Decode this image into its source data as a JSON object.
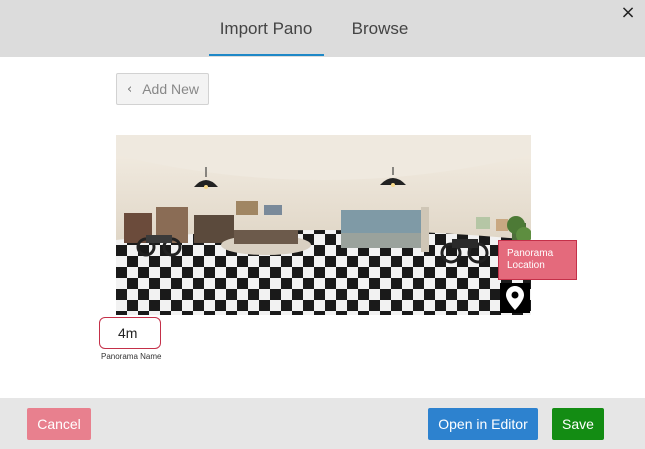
{
  "header": {
    "tabs": [
      {
        "label": "Import Pano",
        "active": true
      },
      {
        "label": "Browse",
        "active": false
      }
    ],
    "close_symbol": "×",
    "active_color": "#1e88c7"
  },
  "toolbar": {
    "add_new_label": "Add New",
    "add_new_icon": "chevron-left-icon"
  },
  "pano": {
    "location_tag": "Panorama Location",
    "pin_icon": "map-pin-icon"
  },
  "name_field": {
    "value": "4m",
    "label": "Panorama Name",
    "border_color": "#c43049"
  },
  "footer": {
    "cancel_label": "Cancel",
    "open_editor_label": "Open in Editor",
    "save_label": "Save",
    "colors": {
      "cancel": "#e8808e",
      "editor": "#2d82cf",
      "save": "#138c13"
    }
  }
}
